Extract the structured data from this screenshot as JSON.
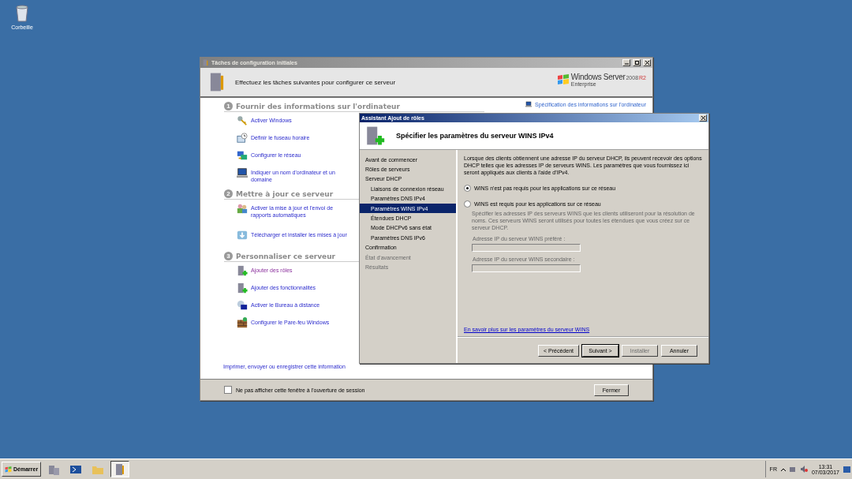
{
  "desktop_icons": [
    {
      "label": "Corbeille"
    }
  ],
  "back_window": {
    "title": "Tâches de configuration initiales",
    "header": "Effectuez les tâches suivantes pour configurer ce serveur",
    "brand": {
      "name": "Windows Server",
      "version": "2008",
      "release": "R2",
      "edition": "Enterprise"
    },
    "side_link": "Spécification des informations sur l'ordinateur",
    "sections": [
      {
        "number": "1",
        "title": "Fournir des informations sur l'ordinateur",
        "tasks": [
          {
            "label": "Activer Windows",
            "kind": "key",
            "visited": false
          },
          {
            "label": "Définir le fuseau horaire",
            "kind": "clock",
            "visited": false
          },
          {
            "label": "Configurer le réseau",
            "kind": "network",
            "visited": false
          },
          {
            "label": "Indiquer un nom d'ordinateur et un domaine",
            "kind": "computer",
            "visited": false
          }
        ]
      },
      {
        "number": "2",
        "title": "Mettre à jour ce serveur",
        "tasks": [
          {
            "label": "Activer la mise à jour et l'envoi de rapports automatiques",
            "kind": "users",
            "visited": false
          },
          {
            "label": "Télécharger et installer les mises à jour",
            "kind": "download",
            "visited": false
          }
        ]
      },
      {
        "number": "3",
        "title": "Personnaliser ce serveur",
        "tasks": [
          {
            "label": "Ajouter des rôles",
            "kind": "server",
            "visited": true
          },
          {
            "label": "Ajouter des fonctionnalités",
            "kind": "server",
            "visited": false
          },
          {
            "label": "Activer le Bureau à distance",
            "kind": "remote",
            "visited": false
          },
          {
            "label": "Configurer le Pare-feu Windows",
            "kind": "firewall",
            "visited": false
          }
        ]
      }
    ],
    "footer_link": "Imprimer, envoyer ou enregistrer cette information",
    "checkbox": {
      "label": "Ne pas afficher cette fenêtre à l'ouverture de session",
      "checked": false
    },
    "close_button": "Fermer"
  },
  "wizard": {
    "title": "Assistant Ajout de rôles",
    "heading": "Spécifier les paramètres du serveur WINS IPv4",
    "steps": [
      {
        "label": "Avant de commencer",
        "selected": false,
        "disabled": false
      },
      {
        "label": "Rôles de serveurs",
        "selected": false,
        "disabled": false
      },
      {
        "label": "Serveur DHCP",
        "selected": false,
        "disabled": false,
        "children": [
          {
            "label": "Liaisons de connexion réseau",
            "selected": false,
            "disabled": false
          },
          {
            "label": "Paramètres DNS IPv4",
            "selected": false,
            "disabled": false
          },
          {
            "label": "Paramètres WINS IPv4",
            "selected": true,
            "disabled": false
          },
          {
            "label": "Étendues DHCP",
            "selected": false,
            "disabled": false
          },
          {
            "label": "Mode DHCPv6 sans état",
            "selected": false,
            "disabled": false
          },
          {
            "label": "Paramètres DNS IPv6",
            "selected": false,
            "disabled": false
          }
        ]
      },
      {
        "label": "Confirmation",
        "selected": false,
        "disabled": false
      },
      {
        "label": "État d'avancement",
        "selected": false,
        "disabled": true
      },
      {
        "label": "Résultats",
        "selected": false,
        "disabled": true
      }
    ],
    "description": "Lorsque des clients obtiennent une adresse IP du serveur DHCP, ils peuvent recevoir des options DHCP telles que les adresses IP de serveurs WINS. Les paramètres que vous fournissez ici seront appliqués aux clients à l'aide d'IPv4.",
    "options": [
      {
        "label": "WINS n'est pas requis pour les applications sur ce réseau",
        "selected": true
      },
      {
        "label": "WINS est requis pour les applications sur ce réseau",
        "selected": false,
        "detail": "Spécifier les adresses IP des serveurs WINS que les clients utiliseront pour la résolution de noms. Ces serveurs WINS seront utilisés pour toutes les étendues que vous créez sur ce serveur DHCP.",
        "fields": [
          {
            "label": "Adresse IP du serveur WINS préféré :"
          },
          {
            "label": "Adresse IP du serveur WINS secondaire :"
          }
        ]
      }
    ],
    "link": "En savoir plus sur les paramètres du serveur WINS",
    "buttons": [
      {
        "label": "< Précédent",
        "kind": "normal",
        "disabled": false
      },
      {
        "label": "Suivant >",
        "kind": "default",
        "disabled": false
      },
      {
        "label": "Installer",
        "kind": "normal",
        "disabled": true
      },
      {
        "label": "Annuler",
        "kind": "normal",
        "disabled": false
      }
    ]
  },
  "taskbar": {
    "start": "Démarrer",
    "apps": [
      {
        "kind": "server-manager",
        "selected": false
      },
      {
        "kind": "powershell",
        "selected": false
      },
      {
        "kind": "folder",
        "selected": false
      },
      {
        "kind": "tasks",
        "selected": true
      }
    ],
    "language": "FR",
    "time": "13:31",
    "date": "07/03/2017"
  }
}
